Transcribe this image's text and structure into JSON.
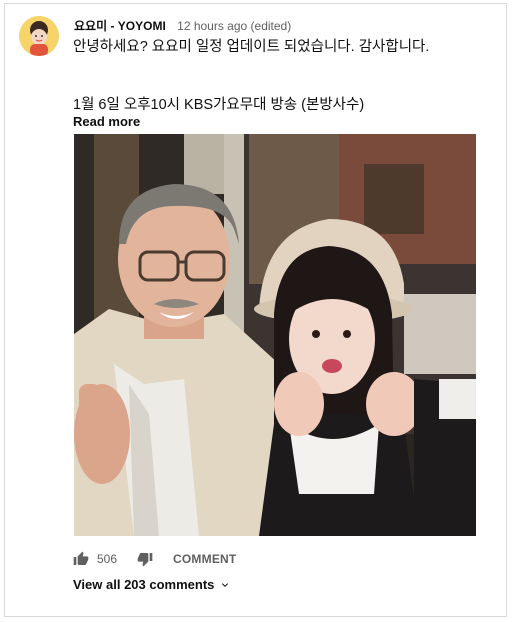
{
  "comment": {
    "author": "요요미 - YOYOMI",
    "time": "12 hours ago (edited)",
    "line1": "안녕하세요? 요요미 일정 업데이트 되었습니다. 감사합니다.",
    "line2": "1월 6일 오후10시 KBS가요무대 방송 (본방사수)",
    "read_more": "Read more"
  },
  "actions": {
    "like_count": "506",
    "comment_label": "COMMENT",
    "view_all": "View all 203 comments"
  },
  "icons": {
    "like": "thumbs-up-icon",
    "dislike": "thumbs-down-icon",
    "expand": "chevron-down-icon"
  }
}
